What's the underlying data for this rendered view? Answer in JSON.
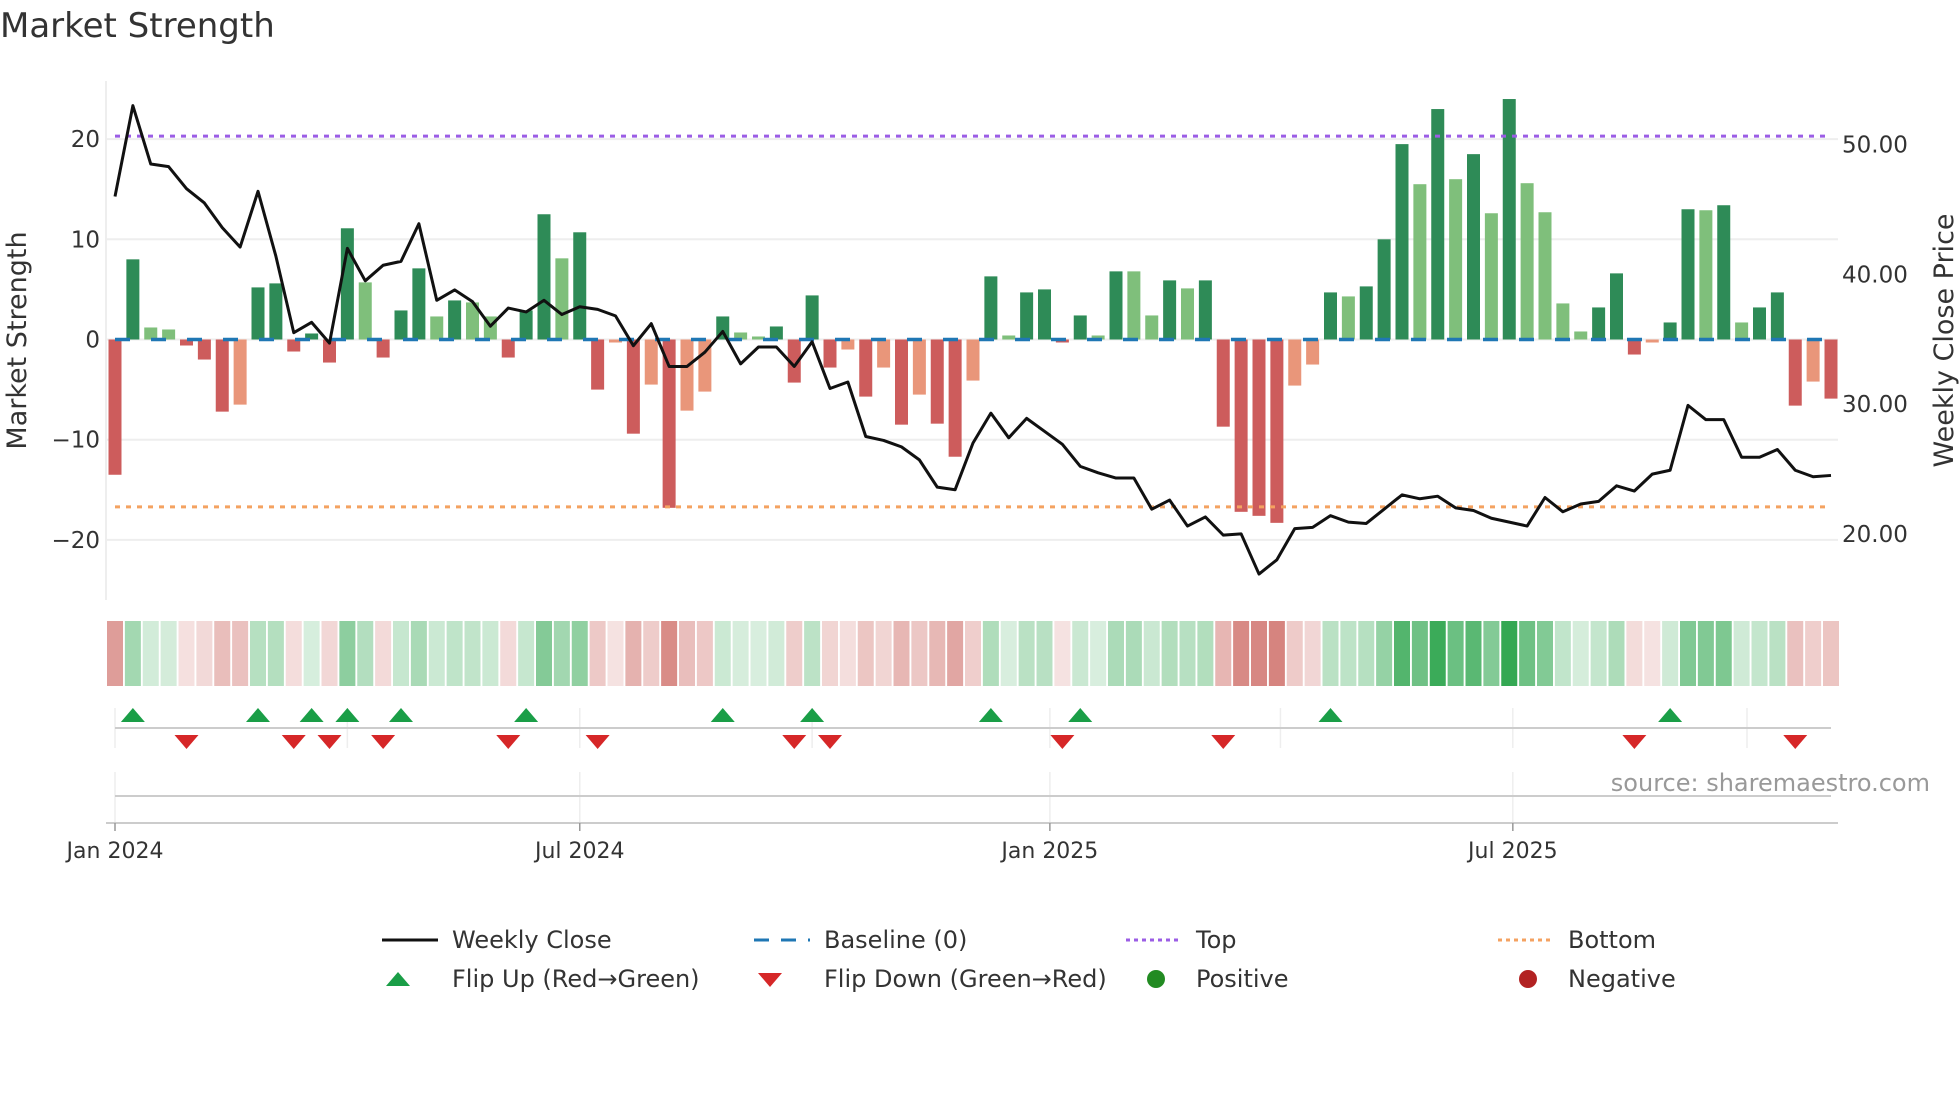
{
  "title": "Market Strength",
  "source": "source: sharemaestro.com",
  "legend": {
    "weekly_close": "Weekly Close",
    "baseline": "Baseline (0)",
    "top": "Top",
    "bottom": "Bottom",
    "flip_up": "Flip Up (Red→Green)",
    "flip_down": "Flip Down (Green→Red)",
    "positive": "Positive",
    "negative": "Negative"
  },
  "colors": {
    "strong_up": "#2e8b57",
    "weak_up": "#7fbf7b",
    "strong_down": "#cd5c5c",
    "weak_down": "#e9967a",
    "line": "#111111",
    "baseline": "#1f77b4",
    "top": "#9b5de5",
    "bottom": "#f4a261",
    "flip_up": "#1a9e47",
    "flip_down": "#d62728",
    "positive": "#228b22",
    "negative": "#b22222"
  },
  "chart_data": {
    "type": "bar",
    "title": "Market Strength",
    "ylabel": "Market Strength",
    "y2label": "Weekly Close Price",
    "ylim": [
      -26,
      25.8
    ],
    "y2lim": [
      14.9,
      54.9
    ],
    "yticks": [
      20,
      10,
      0,
      -10,
      -20
    ],
    "ytick_labels": [
      "20",
      "10",
      "0",
      "−10",
      "−20"
    ],
    "y2ticks": [
      50,
      40,
      30,
      20
    ],
    "y2tick_labels": [
      "50.00",
      "40.00",
      "30.00",
      "20.00"
    ],
    "xticks_week": [
      0,
      26,
      52.3,
      78.2
    ],
    "xtick_labels": [
      "Jan 2024",
      "Jul 2024",
      "Jan 2025",
      "Jul 2025"
    ],
    "minor_grid_week": [
      13,
      39,
      65.2,
      91.3
    ],
    "top_level": 20.3,
    "bottom_level": -16.7,
    "baseline": 0,
    "strength": [
      -13.5,
      8,
      1.2,
      1.0,
      -0.6,
      -2,
      -7.2,
      -6.5,
      5.2,
      5.6,
      -1.2,
      0.6,
      -2.3,
      11.1,
      5.7,
      -1.8,
      2.9,
      7.1,
      2.3,
      3.9,
      3.7,
      2.3,
      -1.8,
      2.9,
      12.5,
      8.1,
      10.7,
      -5,
      -0.3,
      -9.4,
      -4.5,
      -16.8,
      -7.1,
      -5.2,
      2.3,
      0.7,
      0.3,
      1.3,
      -4.3,
      4.4,
      -2.8,
      -1,
      -5.7,
      -2.8,
      -8.5,
      -5.5,
      -8.4,
      -11.7,
      -4.1,
      6.3,
      0.4,
      4.7,
      5.0,
      -0.3,
      2.4,
      0.4,
      6.8,
      6.8,
      2.4,
      5.9,
      5.1,
      5.9,
      -8.7,
      -17.2,
      -17.6,
      -18.3,
      -4.6,
      -2.5,
      4.7,
      4.3,
      5.3,
      10,
      19.5,
      15.5,
      23,
      16,
      18.5,
      12.6,
      24,
      15.6,
      12.7,
      3.6,
      0.8,
      3.2,
      6.6,
      -1.5,
      -0.3,
      1.7,
      13,
      12.9,
      13.4,
      1.7,
      3.2,
      4.7,
      -6.6,
      -4.2,
      -5.9
    ],
    "bar_class": [
      "strong_down",
      "strong_up",
      "weak_up",
      "weak_up",
      "strong_down",
      "strong_down",
      "strong_down",
      "weak_down",
      "strong_up",
      "strong_up",
      "strong_down",
      "strong_up",
      "strong_down",
      "strong_up",
      "weak_up",
      "strong_down",
      "strong_up",
      "strong_up",
      "weak_up",
      "strong_up",
      "weak_up",
      "weak_up",
      "strong_down",
      "strong_up",
      "strong_up",
      "weak_up",
      "strong_up",
      "strong_down",
      "weak_down",
      "strong_down",
      "weak_down",
      "strong_down",
      "weak_down",
      "weak_down",
      "strong_up",
      "weak_up",
      "weak_up",
      "strong_up",
      "strong_down",
      "strong_up",
      "strong_down",
      "weak_down",
      "strong_down",
      "weak_down",
      "strong_down",
      "weak_down",
      "strong_down",
      "strong_down",
      "weak_down",
      "strong_up",
      "weak_up",
      "strong_up",
      "strong_up",
      "strong_down",
      "strong_up",
      "weak_up",
      "strong_up",
      "weak_up",
      "weak_up",
      "strong_up",
      "weak_up",
      "strong_up",
      "strong_down",
      "strong_down",
      "strong_down",
      "strong_down",
      "weak_down",
      "weak_down",
      "strong_up",
      "weak_up",
      "strong_up",
      "strong_up",
      "strong_up",
      "weak_up",
      "strong_up",
      "weak_up",
      "strong_up",
      "weak_up",
      "strong_up",
      "weak_up",
      "weak_up",
      "weak_up",
      "weak_up",
      "strong_up",
      "strong_up",
      "strong_down",
      "weak_down",
      "strong_up",
      "strong_up",
      "weak_up",
      "strong_up",
      "weak_up",
      "strong_up",
      "strong_up",
      "strong_down",
      "weak_down",
      "strong_down"
    ],
    "weekly_close": [
      46.0,
      53.0,
      48.5,
      48.3,
      46.6,
      45.5,
      43.6,
      42.1,
      46.4,
      41.4,
      35.5,
      36.3,
      34.7,
      42.0,
      39.5,
      40.7,
      41.0,
      43.9,
      38.0,
      38.8,
      37.9,
      36.0,
      37.4,
      37.1,
      38.0,
      36.9,
      37.5,
      37.3,
      36.8,
      34.5,
      36.2,
      32.9,
      32.9,
      34.0,
      35.6,
      33.1,
      34.4,
      34.4,
      32.9,
      34.8,
      31.2,
      31.7,
      27.5,
      27.2,
      26.7,
      25.7,
      23.6,
      23.4,
      27.0,
      29.3,
      27.4,
      28.9,
      27.9,
      26.9,
      25.2,
      24.7,
      24.3,
      24.3,
      21.9,
      22.6,
      20.6,
      21.3,
      19.9,
      20.0,
      16.9,
      18.0,
      20.4,
      20.5,
      21.4,
      20.9,
      20.8,
      21.9,
      23.0,
      22.7,
      22.9,
      22.0,
      21.8,
      21.2,
      20.9,
      20.6,
      22.8,
      21.7,
      22.3,
      22.5,
      23.7,
      23.3,
      24.6,
      24.9,
      29.9,
      28.8,
      28.8,
      25.9,
      25.9,
      26.5,
      24.9,
      24.4,
      24.5
    ],
    "flip_up_weeks": [
      1,
      8,
      11,
      13,
      16,
      23,
      34,
      39,
      49,
      54,
      68,
      87
    ],
    "flip_down_weeks": [
      4,
      10,
      12,
      15,
      22,
      27,
      38,
      40,
      53,
      62,
      85,
      94
    ]
  }
}
